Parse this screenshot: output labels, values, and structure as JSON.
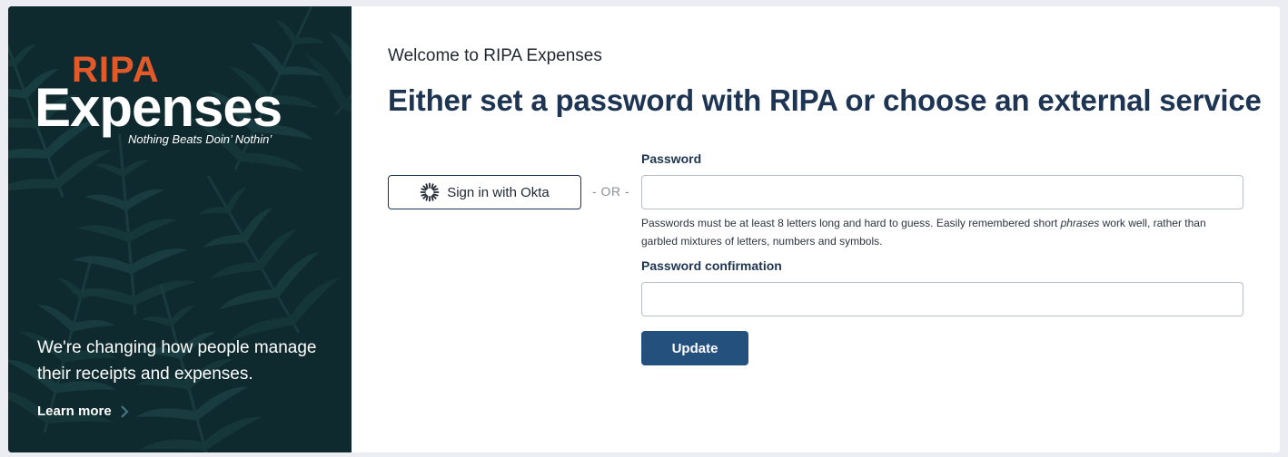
{
  "brand": {
    "logo_top": "RIPA",
    "logo_main": "Expenses",
    "tagline": "Nothing Beats Doin’ Nothin’",
    "description": "We're changing how people manage their receipts and expenses.",
    "learn_more": "Learn more",
    "colors": {
      "panel": "#0f2a2e",
      "accent": "#e2592a"
    }
  },
  "main": {
    "welcome": "Welcome to RIPA Expenses",
    "headline": "Either set a password with RIPA or choose an external service",
    "okta_button": "Sign in with Okta",
    "or_separator": "- OR -",
    "password_label": "Password",
    "password_value": "",
    "password_hint_before": "Passwords must be at least 8 letters long and hard to guess. Easily remembered short ",
    "password_hint_em": "phrases",
    "password_hint_after": " work well, rather than garbled mixtures of letters, numbers and symbols.",
    "confirmation_label": "Password confirmation",
    "confirmation_value": "",
    "update_button": "Update",
    "colors": {
      "primary": "#24507e",
      "heading": "#1d3552"
    }
  }
}
